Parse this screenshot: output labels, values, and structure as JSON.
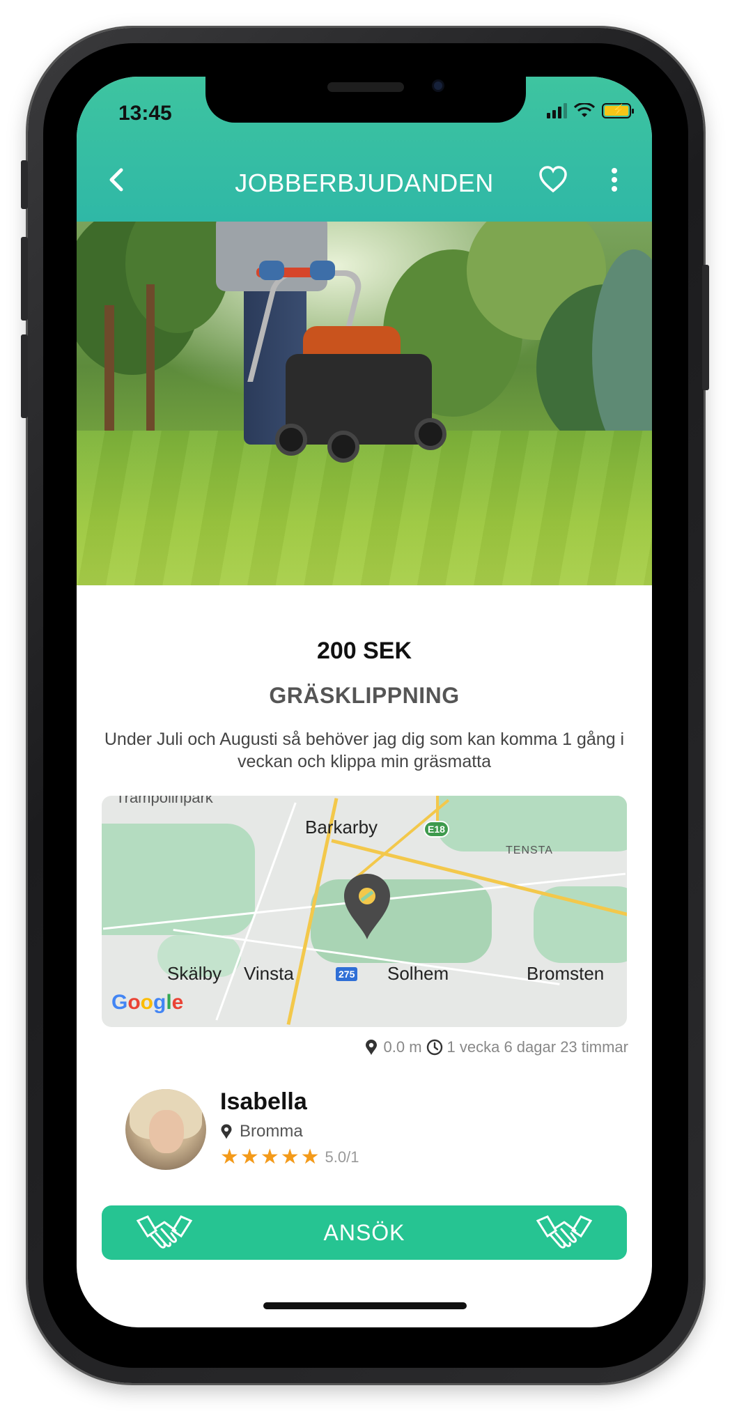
{
  "status_bar": {
    "time": "13:45"
  },
  "nav": {
    "title": "JOBBERBJUDANDEN",
    "back_icon": "chevron-left-icon",
    "favorite_icon": "heart-outline-icon",
    "more_icon": "more-vertical-icon"
  },
  "hero": {
    "carousel_pages": 1,
    "active_page": 1
  },
  "job": {
    "price": "200 SEK",
    "title": "GRÄSKLIPPNING",
    "description": "Under Juli och Augusti så behöver jag dig som kan komma 1 gång i veckan och klippa min gräsmatta"
  },
  "map": {
    "labels": {
      "barkarby": "Barkarby",
      "tensta": "TENSTA",
      "skalby": "Skälby",
      "vinsta": "Vinsta",
      "solhem": "Solhem",
      "bromsten": "Bromsten",
      "top": "Trampolinpark"
    },
    "shields": {
      "e18": "E18",
      "r275": "275"
    },
    "attribution": "Google"
  },
  "meta": {
    "distance": "0.0 m",
    "time_left": "1 vecka 6 dagar 23 timmar"
  },
  "user": {
    "name": "Isabella",
    "location": "Bromma",
    "rating_value": "5.0/1",
    "stars": 5
  },
  "apply": {
    "label": "ANSÖK"
  },
  "colors": {
    "header_gradient_top": "#3ec4a0",
    "header_gradient_bottom": "#2fb8a6",
    "apply_button": "#26c492",
    "star": "#f39a1a"
  }
}
